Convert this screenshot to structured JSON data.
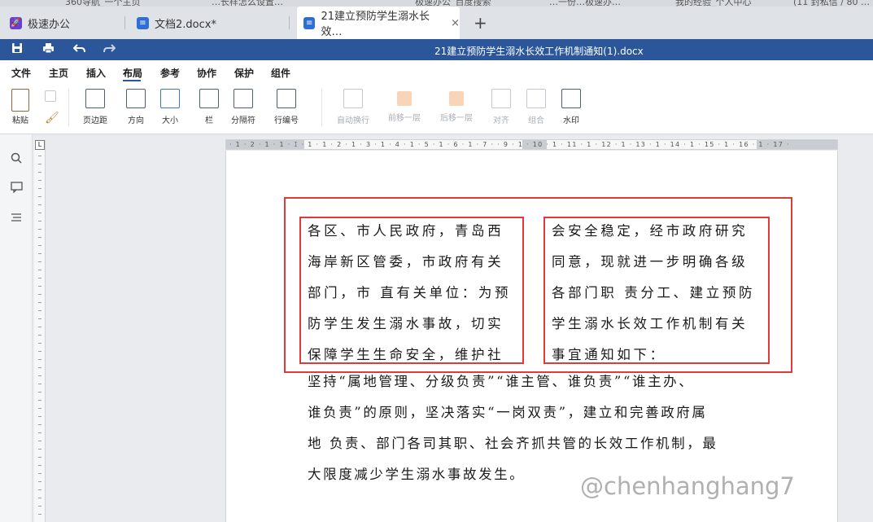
{
  "browser_tabs": [
    "360导航_一个主页",
    "…长样怎么设置…",
    "极速办公_百度搜索",
    "…一份…极速办…",
    "我的经验_个人中心",
    "(11 封私信 / 80 …"
  ],
  "app_tabs": {
    "home": "极速办公",
    "doc1": "文档2.docx*",
    "doc2": "21建立预防学生溺水长效…",
    "close": "×",
    "add": "+"
  },
  "titlebar": {
    "title": "21建立预防学生溺水长效工作机制通知(1).docx",
    "save_icon": "save-icon",
    "print_icon": "print-icon",
    "undo_icon": "undo-icon",
    "redo_icon": "redo-icon"
  },
  "menu": [
    "文件",
    "主页",
    "插入",
    "布局",
    "参考",
    "协作",
    "保护",
    "组件"
  ],
  "active_menu": "布局",
  "ribbon": {
    "paste": "粘贴",
    "margins": "页边距",
    "orientation": "方向",
    "size": "大小",
    "columns": "栏",
    "breaks": "分隔符",
    "line_numbers": "行编号",
    "wrap": "自动换行",
    "bring_forward": "前移一层",
    "send_backward": "后移一层",
    "align": "对齐",
    "group": "组合",
    "watermark": "水印"
  },
  "ruler": {
    "corner": "L",
    "ticks": "· 1 · 2 · 1 · 1 · ꕯ · 1 · 1 · 2 · 1 · 3 · 1 · 4 · 1 · 5 · 1 · 6 · 1 · 7 ·   · 9 · 1 · 10 · 1 · 11 · 1 · 12 · 1 · 13 · 1 · 14 · 1 · 15 · 1 · 16 · 1 · 17 ·"
  },
  "document": {
    "left_column": [
      "各区、市人民政府，青岛西",
      "海岸新区管委，市政府有关",
      "部门，市 直有关单位：为预",
      "防学生发生溺水事故，切实",
      "保障学生生命安全，维护社"
    ],
    "right_column": [
      "会安全稳定，经市政府研究",
      "同意，现就进一步明确各级",
      "各部门职 责分工、建立预防",
      "学生溺水长效工作机制有关",
      "事宜通知如下："
    ],
    "body": [
      "坚持“属地管理、分级负责”“谁主管、谁负责”“谁主办、",
      "谁负责”的原则，坚决落实“一岗双责”，建立和完善政府属",
      "地    负责、部门各司其职、社会齐抓共管的长效工作机制，最",
      "大限度减少学生溺水事故发生。"
    ]
  },
  "watermark": "@chenhanghang7",
  "colors": {
    "titlebar": "#2b579a",
    "highlight_box": "#e03a3a",
    "home_tab_icon": "#6b3fd6",
    "doc_tab_icon": "#2f6ed6"
  }
}
